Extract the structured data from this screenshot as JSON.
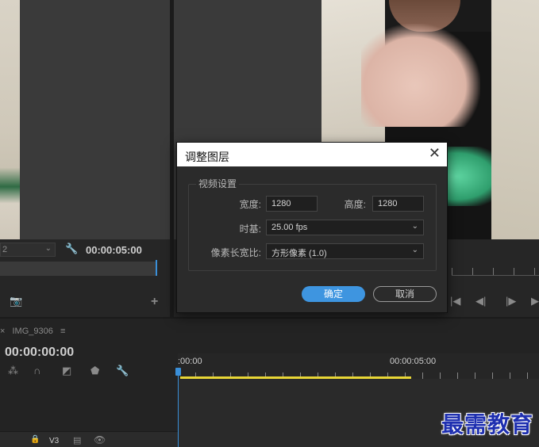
{
  "source_monitor": {
    "timecode": "00:00:05:00",
    "zoom_value": "2"
  },
  "timeline": {
    "sequence_name": "IMG_9306",
    "timecode": "00:00:00:00",
    "ruler_start": ":00:00",
    "ruler_mark": "00:00:05:00",
    "track_label": "V3"
  },
  "dialog": {
    "title": "调整图层",
    "group_title": "视频设置",
    "width_label": "宽度:",
    "width_value": "1280",
    "height_label": "高度:",
    "height_value": "1280",
    "timebase_label": "时基:",
    "timebase_value": "25.00 fps",
    "par_label": "像素长宽比:",
    "par_value": "方形像素 (1.0)",
    "ok_label": "确定",
    "cancel_label": "取消"
  },
  "watermark": "最需教育",
  "colors": {
    "accent": "#3e95e0",
    "workarea": "#e8d636",
    "playhead": "#3a8fd8"
  }
}
